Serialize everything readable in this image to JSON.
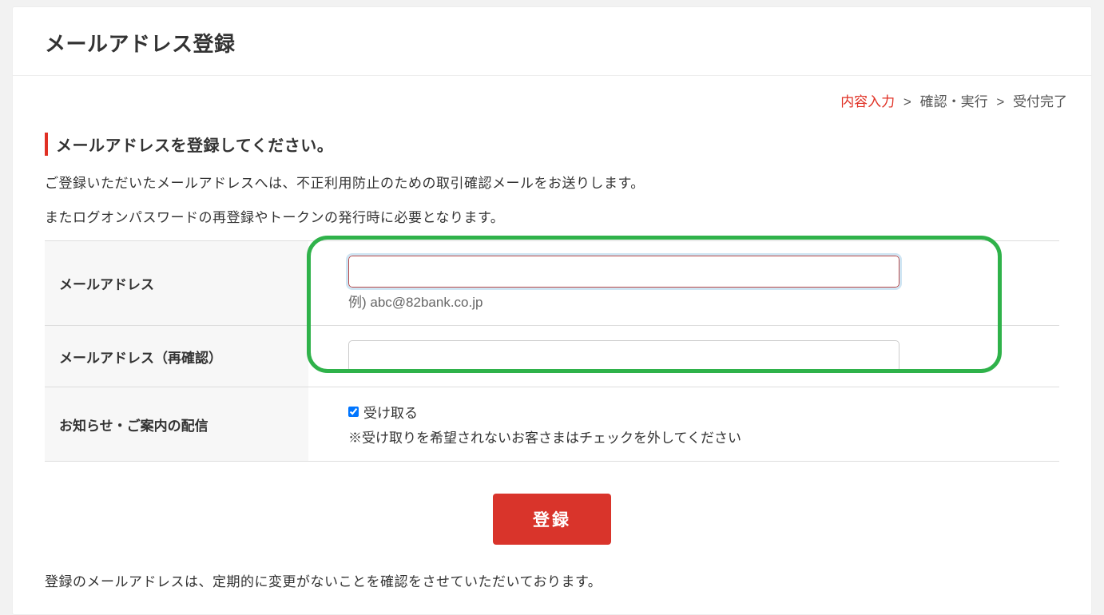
{
  "title": "メールアドレス登録",
  "breadcrumb": {
    "step1": "内容入力",
    "step2": "確認・実行",
    "step3": "受付完了",
    "sep": ">"
  },
  "section_heading": "メールアドレスを登録してください。",
  "desc1": "ご登録いただいたメールアドレスへは、不正利用防止のための取引確認メールをお送りします。",
  "desc2": "またログオンパスワードの再登録やトークンの発行時に必要となります。",
  "rows": {
    "email": {
      "label": "メールアドレス",
      "hint": "例) abc@82bank.co.jp",
      "value": ""
    },
    "email_confirm": {
      "label": "メールアドレス（再確認）",
      "value": ""
    },
    "optin": {
      "label": "お知らせ・ご案内の配信",
      "checkbox_label": "受け取る",
      "note": "※受け取りを希望されないお客さまはチェックを外してください",
      "checked": true
    }
  },
  "submit_label": "登録",
  "footer_note": "登録のメールアドレスは、定期的に変更がないことを確認をさせていただいております。"
}
